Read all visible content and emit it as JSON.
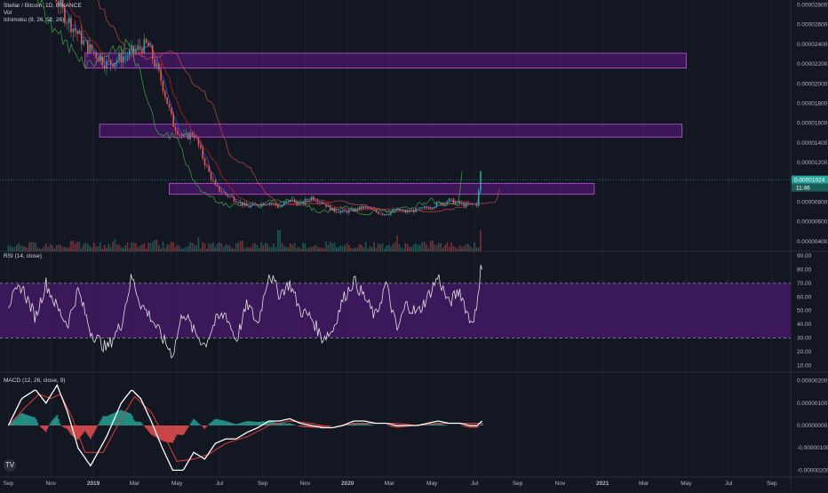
{
  "legend": {
    "symbol": "Stellar / Bitcoin, 1D, BINANCE",
    "volume": "Vol",
    "ichimoku": "Ichimoku (9, 26, 52, 26)",
    "rsi": "RSI (14, close)",
    "macd": "MACD (12, 26, close, 9)"
  },
  "time_axis": [
    {
      "label": "Sep",
      "date": "2018-09-01"
    },
    {
      "label": "Nov",
      "date": "2018-11-01"
    },
    {
      "label": "2019",
      "date": "2019-01-01"
    },
    {
      "label": "Mar",
      "date": "2019-03-01"
    },
    {
      "label": "May",
      "date": "2019-05-01"
    },
    {
      "label": "Jul",
      "date": "2019-07-01"
    },
    {
      "label": "Sep",
      "date": "2019-09-01"
    },
    {
      "label": "Nov",
      "date": "2019-11-01"
    },
    {
      "label": "2020",
      "date": "2020-01-01"
    },
    {
      "label": "Mar",
      "date": "2020-03-01"
    },
    {
      "label": "May",
      "date": "2020-05-01"
    },
    {
      "label": "Jul",
      "date": "2020-07-01"
    },
    {
      "label": "Sep",
      "date": "2020-09-01"
    },
    {
      "label": "Nov",
      "date": "2020-11-01"
    },
    {
      "label": "2021",
      "date": "2021-01-01"
    },
    {
      "label": "Mar",
      "date": "2021-03-01"
    },
    {
      "label": "May",
      "date": "2021-05-01"
    },
    {
      "label": "Jul",
      "date": "2021-07-01"
    },
    {
      "label": "Sep",
      "date": "2021-09-01"
    }
  ],
  "price_axis": [
    "0.00002800",
    "0.00002600",
    "0.00002400",
    "0.00002200",
    "0.00002000",
    "0.00001800",
    "0.00001600",
    "0.00001400",
    "0.00001200",
    "0.00001000",
    "0.00000800",
    "0.00000600",
    "0.00000400"
  ],
  "rsi_axis": [
    "90.00",
    "80.00",
    "70.00",
    "60.00",
    "50.00",
    "40.00",
    "30.00",
    "20.00",
    "10.00"
  ],
  "macd_axis": [
    "0.00000200",
    "0.00000100",
    "0.00000000",
    "-0.00000100",
    "-0.00000200"
  ],
  "last_price_label": "0.00001024",
  "countdown_label": "11:46",
  "logo_text": "TV",
  "colors": {
    "background": "#131722",
    "grid": "#1e222d",
    "candle_up": "#26a69a",
    "candle_down": "#ef5350",
    "zone_fill": "#6a1b9a",
    "zone_border": "#ab47bc",
    "rsi_line": "#e1e1e1",
    "rsi_band": "#4a1a6e",
    "macd_line": "#ffffff",
    "signal_line": "#e53935",
    "last_price_tag": "#26a69a",
    "tenkan": "#2962ff",
    "kijun": "#b71c1c",
    "lagging": "#43a047"
  },
  "chart_data": [
    {
      "type": "candlestick",
      "title": "Stellar / Bitcoin, 1D, BINANCE",
      "x_range": [
        "2018-09-01",
        "2021-09-30"
      ],
      "ylim": [
        3e-06,
        2.85e-05
      ],
      "last_price": 1.024e-05,
      "series": [
        {
          "x": "2018-09-01",
          "y": 3.8e-05
        },
        {
          "x": "2018-10-15",
          "y": 3.3e-05
        },
        {
          "x": "2018-11-20",
          "y": 2.7e-05
        },
        {
          "x": "2018-12-20",
          "y": 2.4e-05
        },
        {
          "x": "2019-01-20",
          "y": 2.2e-05
        },
        {
          "x": "2019-02-20",
          "y": 2.3e-05
        },
        {
          "x": "2019-03-20",
          "y": 2.4e-05
        },
        {
          "x": "2019-04-10",
          "y": 2e-05
        },
        {
          "x": "2019-04-25",
          "y": 1.6e-05
        },
        {
          "x": "2019-05-10",
          "y": 1.45e-05
        },
        {
          "x": "2019-05-25",
          "y": 1.5e-05
        },
        {
          "x": "2019-06-10",
          "y": 1.2e-05
        },
        {
          "x": "2019-06-25",
          "y": 9.5e-06
        },
        {
          "x": "2019-07-10",
          "y": 8.8e-06
        },
        {
          "x": "2019-07-25",
          "y": 8.2e-06
        },
        {
          "x": "2019-08-10",
          "y": 7.5e-06
        },
        {
          "x": "2019-08-25",
          "y": 7.8e-06
        },
        {
          "x": "2019-09-10",
          "y": 8e-06
        },
        {
          "x": "2019-09-25",
          "y": 7.5e-06
        },
        {
          "x": "2019-10-10",
          "y": 8.2e-06
        },
        {
          "x": "2019-10-25",
          "y": 7.8e-06
        },
        {
          "x": "2019-11-10",
          "y": 8.5e-06
        },
        {
          "x": "2019-11-25",
          "y": 8e-06
        },
        {
          "x": "2019-12-10",
          "y": 7.2e-06
        },
        {
          "x": "2019-12-25",
          "y": 7e-06
        },
        {
          "x": "2020-01-10",
          "y": 7.2e-06
        },
        {
          "x": "2020-01-25",
          "y": 7.5e-06
        },
        {
          "x": "2020-02-10",
          "y": 7e-06
        },
        {
          "x": "2020-02-25",
          "y": 6.8e-06
        },
        {
          "x": "2020-03-10",
          "y": 7.2e-06
        },
        {
          "x": "2020-03-25",
          "y": 7e-06
        },
        {
          "x": "2020-04-10",
          "y": 7.2e-06
        },
        {
          "x": "2020-04-25",
          "y": 7.5e-06
        },
        {
          "x": "2020-05-10",
          "y": 7.8e-06
        },
        {
          "x": "2020-05-25",
          "y": 8.2e-06
        },
        {
          "x": "2020-06-10",
          "y": 7.8e-06
        },
        {
          "x": "2020-06-25",
          "y": 7.7e-06
        },
        {
          "x": "2020-07-05",
          "y": 7.8e-06
        },
        {
          "x": "2020-07-10",
          "y": 1.1e-05
        },
        {
          "x": "2020-07-12",
          "y": 1.024e-05
        }
      ]
    },
    {
      "type": "bar",
      "title": "Vol",
      "note_series": "volume (relative)",
      "series": [
        {
          "x": "2018-10-01",
          "y": 0.3
        },
        {
          "x": "2018-12-01",
          "y": 0.4
        },
        {
          "x": "2019-02-01",
          "y": 0.5
        },
        {
          "x": "2019-04-01",
          "y": 0.45
        },
        {
          "x": "2019-06-01",
          "y": 0.6
        },
        {
          "x": "2019-08-01",
          "y": 0.4
        },
        {
          "x": "2019-09-25",
          "y": 1.0
        },
        {
          "x": "2019-12-01",
          "y": 0.35
        },
        {
          "x": "2020-03-12",
          "y": 0.7
        },
        {
          "x": "2020-05-01",
          "y": 0.4
        },
        {
          "x": "2020-07-10",
          "y": 1.0
        }
      ]
    },
    {
      "type": "line",
      "title": "RSI (14, close)",
      "ylim": [
        5,
        92
      ],
      "bands": [
        30,
        70
      ],
      "series": [
        {
          "name": "RSI",
          "points": [
            [
              "2018-09-01",
              55
            ],
            [
              "2018-09-20",
              68
            ],
            [
              "2018-10-10",
              45
            ],
            [
              "2018-10-25",
              70
            ],
            [
              "2018-11-10",
              52
            ],
            [
              "2018-11-25",
              40
            ],
            [
              "2018-12-10",
              65
            ],
            [
              "2018-12-28",
              35
            ],
            [
              "2019-01-20",
              22
            ],
            [
              "2019-02-10",
              40
            ],
            [
              "2019-02-25",
              75
            ],
            [
              "2019-03-10",
              55
            ],
            [
              "2019-03-25",
              45
            ],
            [
              "2019-04-10",
              30
            ],
            [
              "2019-04-25",
              18
            ],
            [
              "2019-05-10",
              50
            ],
            [
              "2019-05-25",
              35
            ],
            [
              "2019-06-10",
              25
            ],
            [
              "2019-06-25",
              42
            ],
            [
              "2019-07-10",
              48
            ],
            [
              "2019-07-25",
              28
            ],
            [
              "2019-08-10",
              55
            ],
            [
              "2019-08-25",
              40
            ],
            [
              "2019-09-10",
              78
            ],
            [
              "2019-09-25",
              62
            ],
            [
              "2019-10-10",
              70
            ],
            [
              "2019-10-25",
              50
            ],
            [
              "2019-11-10",
              45
            ],
            [
              "2019-11-25",
              30
            ],
            [
              "2019-12-10",
              35
            ],
            [
              "2019-12-25",
              58
            ],
            [
              "2020-01-10",
              72
            ],
            [
              "2020-01-25",
              60
            ],
            [
              "2020-02-10",
              45
            ],
            [
              "2020-02-25",
              70
            ],
            [
              "2020-03-12",
              35
            ],
            [
              "2020-03-25",
              55
            ],
            [
              "2020-04-10",
              48
            ],
            [
              "2020-04-25",
              60
            ],
            [
              "2020-05-10",
              75
            ],
            [
              "2020-05-25",
              55
            ],
            [
              "2020-06-10",
              65
            ],
            [
              "2020-06-25",
              42
            ],
            [
              "2020-07-05",
              50
            ],
            [
              "2020-07-10",
              85
            ],
            [
              "2020-07-12",
              83
            ]
          ]
        }
      ]
    },
    {
      "type": "line",
      "title": "MACD (12, 26, close, 9)",
      "ylim": [
        -2.3e-06,
        2.3e-06
      ],
      "series": [
        {
          "name": "MACD",
          "points": [
            [
              "2018-09-01",
              0
            ],
            [
              "2018-09-20",
              1.2e-06
            ],
            [
              "2018-10-10",
              1.6e-06
            ],
            [
              "2018-10-25",
              1e-06
            ],
            [
              "2018-11-10",
              1.8e-06
            ],
            [
              "2018-11-25",
              6e-07
            ],
            [
              "2018-12-10",
              -1e-06
            ],
            [
              "2018-12-28",
              -1.8e-06
            ],
            [
              "2019-01-20",
              -5e-07
            ],
            [
              "2019-02-10",
              1e-06
            ],
            [
              "2019-02-25",
              1.6e-06
            ],
            [
              "2019-03-10",
              1.2e-06
            ],
            [
              "2019-03-25",
              2e-07
            ],
            [
              "2019-04-10",
              -1e-06
            ],
            [
              "2019-04-25",
              -2e-06
            ],
            [
              "2019-05-10",
              -2e-06
            ],
            [
              "2019-05-25",
              -1.2e-06
            ],
            [
              "2019-06-10",
              -1.5e-06
            ],
            [
              "2019-06-25",
              -8e-07
            ],
            [
              "2019-07-10",
              -6e-07
            ],
            [
              "2019-07-25",
              -6e-07
            ],
            [
              "2019-08-10",
              -3e-07
            ],
            [
              "2019-08-25",
              -1e-07
            ],
            [
              "2019-09-10",
              2e-07
            ],
            [
              "2019-09-25",
              2e-07
            ],
            [
              "2019-10-10",
              3e-07
            ],
            [
              "2019-10-25",
              1e-07
            ],
            [
              "2019-11-10",
              0
            ],
            [
              "2019-11-25",
              -1e-07
            ],
            [
              "2019-12-10",
              -1e-07
            ],
            [
              "2019-12-25",
              0
            ],
            [
              "2020-01-10",
              2e-07
            ],
            [
              "2020-01-25",
              2e-07
            ],
            [
              "2020-02-10",
              1e-07
            ],
            [
              "2020-02-25",
              1e-07
            ],
            [
              "2020-03-12",
              0
            ],
            [
              "2020-03-25",
              0
            ],
            [
              "2020-04-10",
              0
            ],
            [
              "2020-04-25",
              1e-07
            ],
            [
              "2020-05-10",
              2e-07
            ],
            [
              "2020-05-25",
              1e-07
            ],
            [
              "2020-06-10",
              1e-07
            ],
            [
              "2020-06-25",
              0
            ],
            [
              "2020-07-05",
              0
            ],
            [
              "2020-07-12",
              2e-07
            ]
          ]
        },
        {
          "name": "Signal",
          "points": [
            [
              "2018-09-01",
              0
            ],
            [
              "2018-09-25",
              8e-07
            ],
            [
              "2018-10-15",
              1.4e-06
            ],
            [
              "2018-11-01",
              1.2e-06
            ],
            [
              "2018-11-15",
              1.4e-06
            ],
            [
              "2018-12-01",
              4e-07
            ],
            [
              "2018-12-20",
              -1.2e-06
            ],
            [
              "2019-01-15",
              -1.2e-06
            ],
            [
              "2019-02-10",
              3e-07
            ],
            [
              "2019-03-01",
              1.3e-06
            ],
            [
              "2019-03-25",
              6e-07
            ],
            [
              "2019-04-15",
              -6e-07
            ],
            [
              "2019-05-01",
              -1.6e-06
            ],
            [
              "2019-05-25",
              -1.5e-06
            ],
            [
              "2019-06-15",
              -1.3e-06
            ],
            [
              "2019-07-10",
              -8e-07
            ],
            [
              "2019-08-10",
              -5e-07
            ],
            [
              "2019-09-10",
              0
            ],
            [
              "2019-10-10",
              2e-07
            ],
            [
              "2019-11-10",
              1e-07
            ],
            [
              "2019-12-10",
              -1e-07
            ],
            [
              "2020-01-10",
              1e-07
            ],
            [
              "2020-02-10",
              1e-07
            ],
            [
              "2020-03-12",
              1e-07
            ],
            [
              "2020-04-10",
              0
            ],
            [
              "2020-05-10",
              1e-07
            ],
            [
              "2020-06-10",
              1e-07
            ],
            [
              "2020-07-12",
              1e-07
            ]
          ]
        }
      ]
    }
  ],
  "zones": [
    {
      "from": "2018-12-20",
      "to": "2021-05-01",
      "top": 2.31e-05,
      "bottom": 2.16e-05
    },
    {
      "from": "2019-01-10",
      "to": "2021-04-25",
      "top": 1.59e-05,
      "bottom": 1.46e-05
    },
    {
      "from": "2019-04-20",
      "to": "2020-12-20",
      "top": 9.9e-06,
      "bottom": 8.8e-06
    }
  ]
}
